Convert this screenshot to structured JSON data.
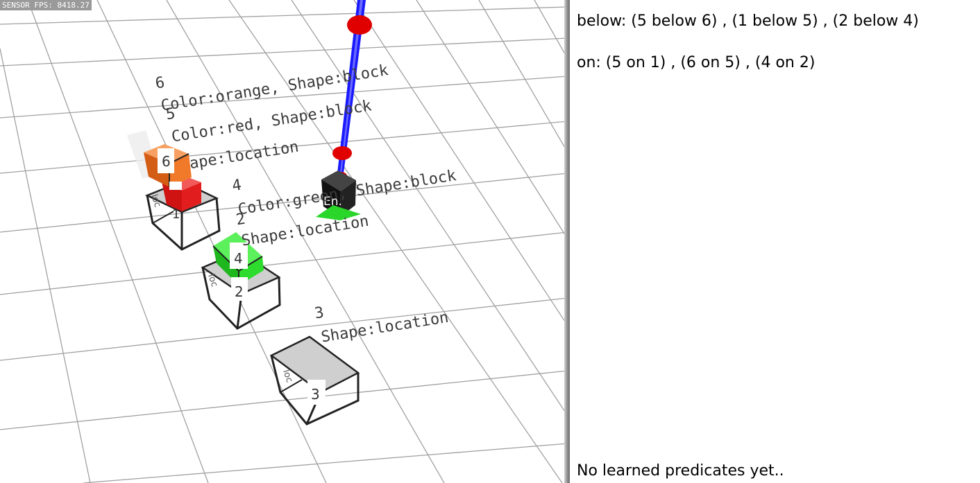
{
  "sensor_fps": "SENSOR FPS: 8418.27",
  "objects": [
    {
      "id": "6",
      "label_id": "6",
      "description": "Color:orange, Shape:block",
      "color": "#f07a2a"
    },
    {
      "id": "5",
      "label_id": "5",
      "description": "Color:red, Shape:block",
      "color": "#e21d1d"
    },
    {
      "id": "1",
      "description": "ape:location"
    },
    {
      "id": "4",
      "label_id": "4",
      "description": "Color:green, Shape:block",
      "color": "#2ddc2d"
    },
    {
      "id": "2",
      "label_id": "2",
      "description": "Shape:location"
    },
    {
      "id": "3",
      "label_id": "3",
      "description": "Shape:location"
    }
  ],
  "tags": {
    "t6": "6",
    "t4": "4",
    "t2": "2",
    "t3": "3",
    "t1": "1",
    "loc": "loc",
    "gripper": "En."
  },
  "predicates": {
    "below": "below: (5 below 6) , (1 below 5) , (2 below 4)",
    "on": "on: (5 on 1) , (6 on 5) , (4 on 2)",
    "learned": "No learned predicates yet.."
  },
  "colors": {
    "arm": "#1a1aff",
    "joint": "#e00000",
    "gripper": "#111111",
    "location_box": "#cfcfcf",
    "grid": "#9a9a9a"
  }
}
